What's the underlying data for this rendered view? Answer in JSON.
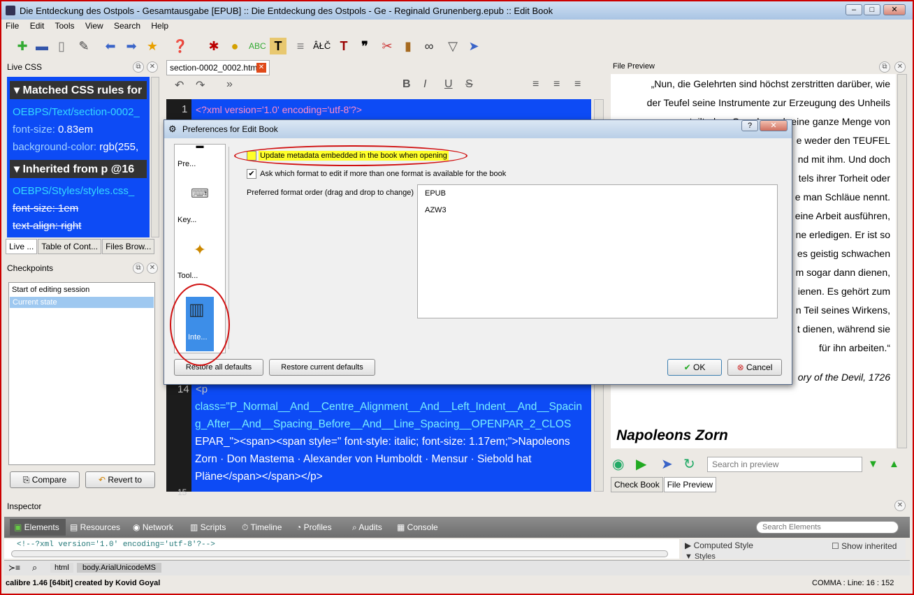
{
  "window": {
    "title": "Die Entdeckung des Ostpols - Gesamtausgabe [EPUB] :: Die Entdeckung des Ostpols - Ge - Reginald Grunenberg.epub :: Edit Book"
  },
  "menu": [
    "File",
    "Edit",
    "Tools",
    "View",
    "Search",
    "Help"
  ],
  "live_css": {
    "title": "Live CSS",
    "matched_header": "Matched CSS rules for",
    "source1": "OEBPS/Text/section-0002_",
    "prop1_name": "font-size:",
    "prop1_value": "0.83em",
    "prop2_name": "background-color:",
    "prop2_value": "rgb(255,",
    "inherited_header": "Inherited from p @16",
    "source2": "OEBPS/Styles/styles.css_",
    "prop3_name": "font-size:",
    "prop3_value": "1em",
    "prop4": "text-align: right"
  },
  "left_tabs": [
    "Live ...",
    "Table of Cont...",
    "Files Brow..."
  ],
  "checkpoints": {
    "title": "Checkpoints",
    "items": [
      "Start of editing session",
      "Current state"
    ],
    "compare": "Compare",
    "revert": "Revert to"
  },
  "editor": {
    "tab": "section-0002_0002.html",
    "line1_no": "1",
    "line1": "<?xml version='1.0' encoding='utf-8'?>",
    "line14_no": "14",
    "line14_p": "<p",
    "line14_class": "class=\"P_Normal__And__Centre_Alignment__And__Left_Indent__And__Spacin",
    "line14_class2": "g_After__And__Spacing_Before__And__Line_Spacing__OPENPAR_2_CLOS",
    "line14_class3": "EPAR_\"><span><span style=\" font-style: italic; font-size: 1.17em;\">Napoleons",
    "line14_text": "Zorn · Don Mastema · Alexander von Humboldt · Mensur · Siebold hat",
    "line14_end": "Pläne</span></span></p>",
    "line15_no": "15"
  },
  "preview": {
    "title": "File Preview",
    "lines": [
      "„Nun, die Gelehrten sind höchst zerstritten darüber, wie",
      "der Teufel seine Instrumente zur Erzeugung des Unheils",
      "verteilt, dem Grunde nach eine ganze Menge von",
      "e weder den TEUFEL",
      "nd mit ihm. Und doch",
      "tels ihrer Torheit oder",
      "e man Schläue nennt.",
      "eine Arbeit ausführen,",
      "ne erledigen. Er ist so",
      "es geistig schwachen",
      "m sogar dann dienen,",
      "ienen. Es gehört zum",
      "n Teil seines Wirkens,",
      "t dienen, während sie",
      "für ihn arbeiten.“"
    ],
    "citation": "ory of the Devil, 1726",
    "heading": "Napoleons Zorn",
    "search_placeholder": "Search in preview",
    "tab_check": "Check Book",
    "tab_preview": "File Preview"
  },
  "dialog": {
    "title": "Preferences for Edit Book",
    "sidebar": [
      "Pre...",
      "Key...",
      "Tool...",
      "Inte..."
    ],
    "opt1": "Update metadata embedded in the book when opening",
    "opt2": "Ask which format to edit if more than one format is available for the book",
    "order_label": "Preferred format order (drag and drop to change)",
    "formats": [
      "EPUB",
      "AZW3"
    ],
    "restore_all": "Restore all defaults",
    "restore_current": "Restore current defaults",
    "ok": "OK",
    "cancel": "Cancel"
  },
  "inspector": {
    "title": "Inspector",
    "tabs": [
      "Elements",
      "Resources",
      "Network",
      "Scripts",
      "Timeline",
      "Profiles",
      "Audits",
      "Console"
    ],
    "search_placeholder": "Search Elements",
    "code": "<!--?xml version='1.0' encoding='utf-8'?-->",
    "computed": "Computed Style",
    "show_inherited": "Show inherited",
    "styles": "Styles",
    "crumb1": "html",
    "crumb2": "body.ArialUnicodeMS"
  },
  "status": {
    "left": "calibre 1.46 [64bit] created by Kovid Goyal",
    "right": "COMMA : Line: 16 : 152"
  }
}
